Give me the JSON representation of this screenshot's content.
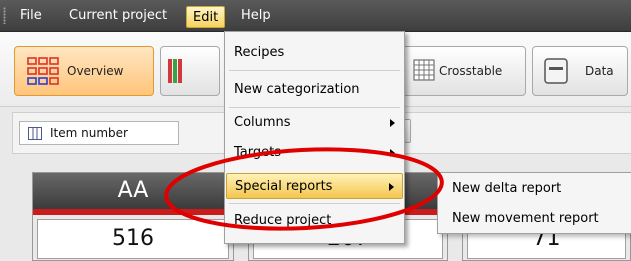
{
  "menubar": {
    "items": [
      {
        "label": "File"
      },
      {
        "label": "Current project"
      },
      {
        "label": "Edit"
      },
      {
        "label": "Help"
      }
    ]
  },
  "toolbar": {
    "tabs": [
      {
        "label": "Overview",
        "icon": "overview-grid-icon"
      },
      {
        "label": "",
        "icon": "chart-icon"
      },
      {
        "label": "Crosstable",
        "icon": "crosstable-icon"
      },
      {
        "label": "Data",
        "icon": "data-icon"
      }
    ]
  },
  "row2": {
    "combo_value": "Item number",
    "percent_label": "%"
  },
  "cards": [
    {
      "header": "AA",
      "value": "516"
    },
    {
      "header": "",
      "value": "207"
    },
    {
      "header": "",
      "value": "71"
    }
  ],
  "edit_menu": {
    "items": [
      {
        "label": "Recipes"
      },
      {
        "label": "New categorization"
      },
      {
        "label": "Columns"
      },
      {
        "label": "Targets"
      },
      {
        "label": "Special reports"
      },
      {
        "label": "Reduce project"
      }
    ]
  },
  "special_reports_submenu": {
    "items": [
      {
        "label": "New delta report"
      },
      {
        "label": "New movement report"
      }
    ]
  },
  "colors": {
    "menubar": "#4a4a4a",
    "highlight": "#f6d15d",
    "selected_tab": "#ffc57a",
    "card_red": "#c91d1d",
    "annotation_red": "#e00000"
  }
}
